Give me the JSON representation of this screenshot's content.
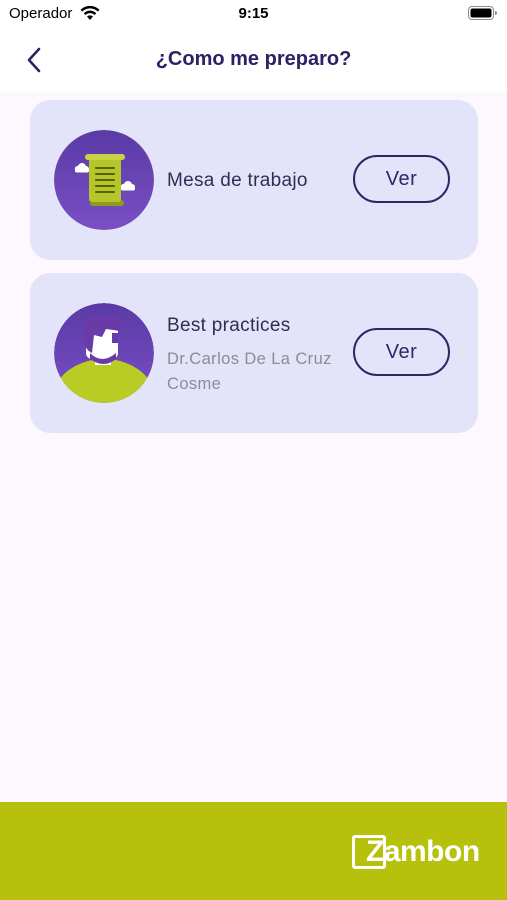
{
  "status_bar": {
    "carrier": "Operador",
    "time": "9:15"
  },
  "nav": {
    "title": "¿Como me preparo?",
    "back_icon": "chevron-left-icon"
  },
  "cards": [
    {
      "title": "Mesa de trabajo",
      "icon": "document-scroll-icon",
      "button_label": "Ver"
    },
    {
      "title": "Best practices",
      "subtitle": "Dr.Carlos De La Cruz Cosme",
      "icon": "person-avatar-icon",
      "button_label": "Ver"
    }
  ],
  "footer": {
    "brand": "Zambon"
  },
  "colors": {
    "title": "#2a2266",
    "card_bg": "#e3e4fa",
    "content_bg": "#fcf8fe",
    "footer_bg": "#b7c00a",
    "avatar_purple": "#6b44b4",
    "accent_green": "#b9cc25"
  }
}
